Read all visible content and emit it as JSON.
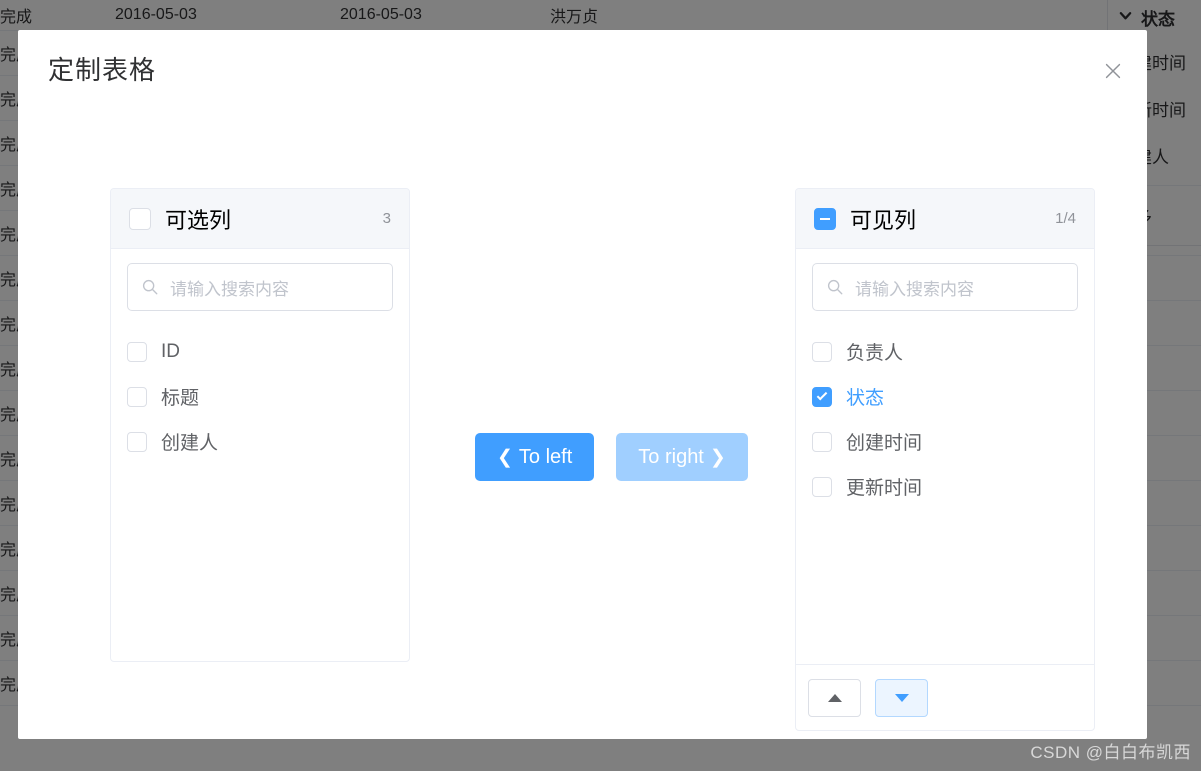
{
  "background": {
    "table_row": {
      "status": "完成",
      "date_created": "2016-05-03",
      "date_updated": "2016-05-03",
      "owner": "洪万贞"
    },
    "row_repeat": 16,
    "dropdown": {
      "header": "状态",
      "header_icon": "chevron-down-icon",
      "items": [
        "创建时间",
        "更新时间",
        "创建人",
        "更多"
      ]
    }
  },
  "modal": {
    "title": "定制表格",
    "close_icon": "close-icon"
  },
  "transfer": {
    "left_panel": {
      "header_label": "可选列",
      "count": "3",
      "header_checked": false,
      "search": {
        "placeholder": "请输入搜索内容",
        "value": "",
        "icon": "search-icon"
      },
      "items": [
        {
          "label": "ID",
          "checked": false
        },
        {
          "label": "标题",
          "checked": false
        },
        {
          "label": "创建人",
          "checked": false
        }
      ]
    },
    "right_panel": {
      "header_label": "可见列",
      "count": "1/4",
      "header_state": "indeterminate",
      "search": {
        "placeholder": "请输入搜索内容",
        "value": "",
        "icon": "search-icon"
      },
      "items": [
        {
          "label": "负责人",
          "checked": false
        },
        {
          "label": "状态",
          "checked": true
        },
        {
          "label": "创建时间",
          "checked": false
        },
        {
          "label": "更新时间",
          "checked": false
        }
      ],
      "footer": {
        "move_up_icon": "triangle-up-icon",
        "move_down_icon": "triangle-down-icon",
        "move_up_enabled": false,
        "move_down_enabled": true
      }
    },
    "buttons": {
      "to_left": {
        "label": "To left",
        "icon": "chevron-left-icon",
        "state": "enabled"
      },
      "to_right": {
        "label": "To right",
        "icon": "chevron-right-icon",
        "state": "disabled"
      }
    }
  },
  "watermark": "CSDN @白白布凯西",
  "colors": {
    "accent": "#409eff",
    "accent_disabled": "#a0cfff",
    "accent_light_bg": "#ecf5ff",
    "panel_header_bg": "#f5f7fa",
    "border": "#ebeef5",
    "text_primary": "#303133",
    "text_regular": "#606266",
    "text_placeholder": "#c0c4cc"
  }
}
